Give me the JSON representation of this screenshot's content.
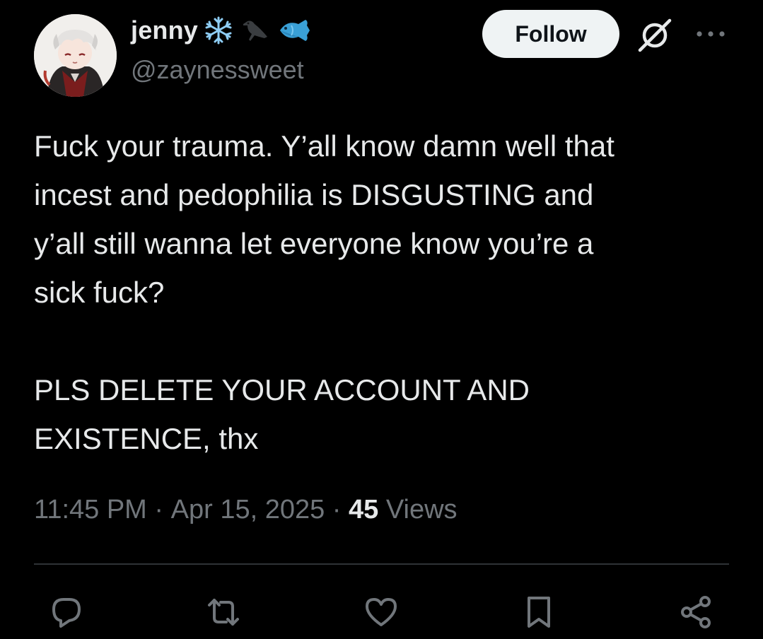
{
  "author": {
    "display_name": "jenny",
    "handle": "@zaynessweet",
    "emojis": [
      "snowflake-emoji",
      "crow-emoji",
      "fish-emoji"
    ],
    "avatar_icon": "anime-character-avatar"
  },
  "header": {
    "follow_label": "Follow",
    "grok_icon": "grok-icon",
    "more_icon": "more-icon"
  },
  "post": {
    "paragraph_1": "Fuck your trauma. Y’all know damn well that\nincest and pedophilia is DISGUSTING and\ny’all still wanna let everyone know you’re a\nsick fuck?",
    "paragraph_2": "PLS DELETE YOUR ACCOUNT AND\nEXISTENCE, thx"
  },
  "meta": {
    "time": "11:45 PM",
    "separator": "·",
    "date": "Apr 15, 2025",
    "views_count": "45",
    "views_label": "Views"
  },
  "actions": [
    "reply-icon",
    "repost-icon",
    "like-icon",
    "bookmark-icon",
    "share-icon"
  ],
  "colors": {
    "background": "#000000",
    "text_primary": "#e7e9ea",
    "text_secondary": "#71767b",
    "follow_bg": "#eff3f4",
    "divider": "#2f3336"
  }
}
